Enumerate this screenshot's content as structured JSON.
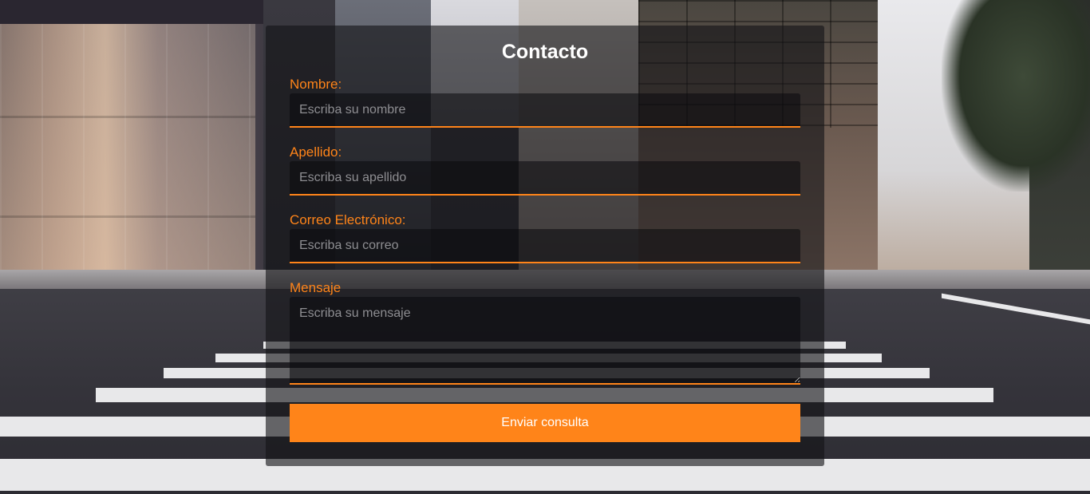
{
  "form": {
    "title": "Contacto",
    "fields": [
      {
        "label": "Nombre:",
        "placeholder": "Escriba su nombre"
      },
      {
        "label": "Apellido:",
        "placeholder": "Escriba su apellido"
      },
      {
        "label": "Correo Electrónico:",
        "placeholder": "Escriba su correo"
      },
      {
        "label": "Mensaje",
        "placeholder": "Escriba su mensaje"
      }
    ],
    "submit_label": "Enviar consulta"
  },
  "colors": {
    "accent": "#ff8419",
    "panel_bg": "rgba(20,20,22,0.62)",
    "title_text": "#ffffff"
  }
}
